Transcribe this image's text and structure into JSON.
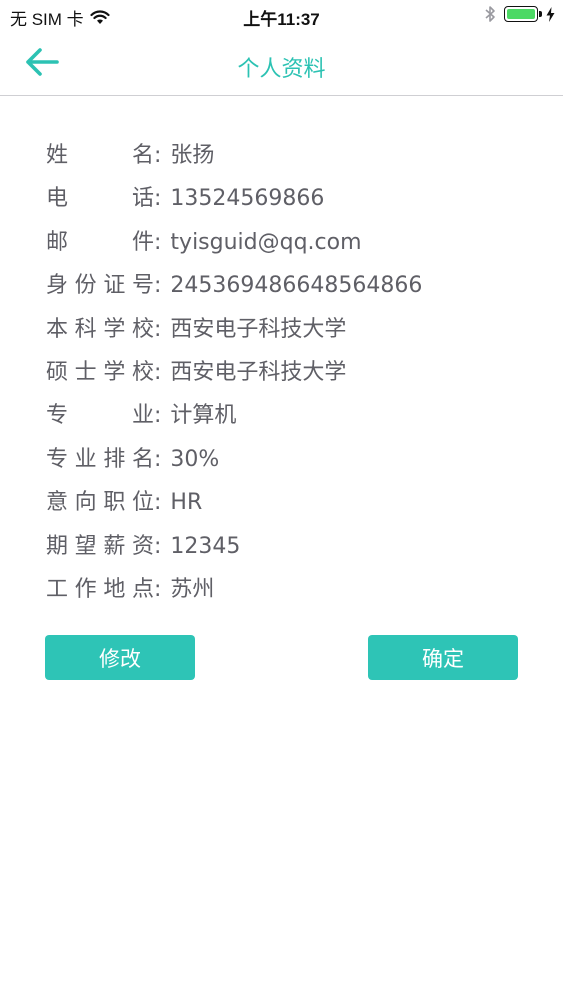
{
  "status_bar": {
    "carrier": "无 SIM 卡",
    "time": "上午11:37",
    "battery_percent": 1.0,
    "battery_color": "#4cd964",
    "icons": [
      "wifi-icon",
      "bluetooth-icon",
      "battery-icon",
      "charging-icon"
    ]
  },
  "nav": {
    "title": "个人资料",
    "back_icon": "arrow-left-icon",
    "accent_color": "#2cc2b3"
  },
  "profile": {
    "fields": [
      {
        "label": "姓名",
        "colon": ":",
        "value": "张扬"
      },
      {
        "label": "电话",
        "colon": ":",
        "value": "13524569866"
      },
      {
        "label": "邮件",
        "colon": ":",
        "value": "tyisguid@qq.com"
      },
      {
        "label": "身份证号",
        "colon": ":",
        "value": "245369486648564866"
      },
      {
        "label": "本科学校",
        "colon": ":",
        "value": "西安电子科技大学"
      },
      {
        "label": "硕士学校",
        "colon": ":",
        "value": "西安电子科技大学"
      },
      {
        "label": "专业",
        "colon": ":",
        "value": "计算机"
      },
      {
        "label": "专业排名",
        "colon": ":",
        "value": "30%"
      },
      {
        "label": "意向职位",
        "colon": ":",
        "value": "HR"
      },
      {
        "label": "期望薪资",
        "colon": ":",
        "value": "12345"
      },
      {
        "label": "工作地点",
        "colon": ":",
        "value": "苏州"
      }
    ]
  },
  "actions": {
    "edit_label": "修改",
    "confirm_label": "确定",
    "button_color": "#2ec4b6"
  }
}
